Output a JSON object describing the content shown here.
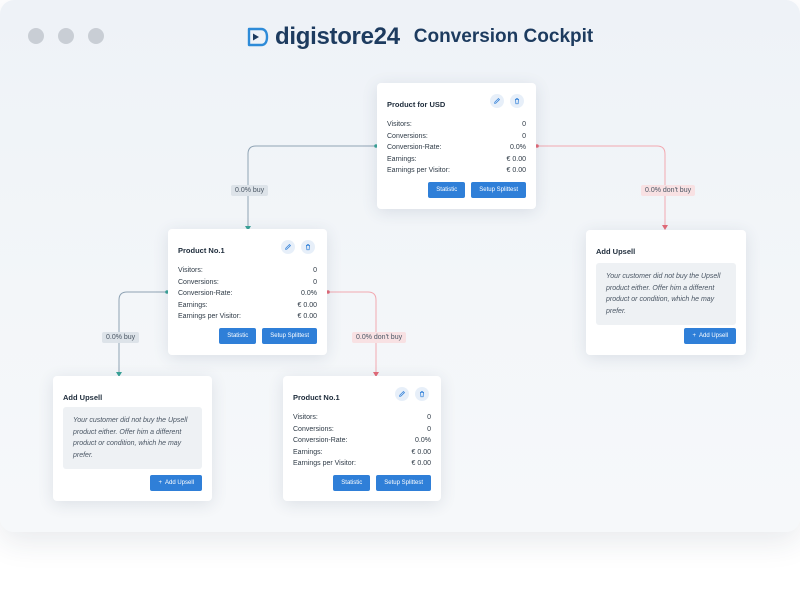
{
  "app": {
    "brand_name": "digistore24",
    "title": "Conversion Cockpit",
    "logo_icon": "digistore24-logo-icon"
  },
  "colors": {
    "brand": "#1d3b5f",
    "button": "#2f7fd8",
    "buy_line": "#8fa3b4",
    "buy_arrow": "#3aa398",
    "nobuy_line": "#f2a9b1",
    "nobuy_arrow": "#e36a78"
  },
  "stat_labels": {
    "visitors": "Visitors:",
    "conversions": "Conversions:",
    "rate": "Conversion-Rate:",
    "earnings": "Earnings:",
    "epv": "Earnings per Visitor:"
  },
  "buttons": {
    "statistic": "Statistic",
    "splittest": "Setup Splittest",
    "add_upsell": "Add Upsell"
  },
  "icons": {
    "edit": "pencil-icon",
    "delete": "trash-icon",
    "add": "plus-icon"
  },
  "root": {
    "title": "Product for USD",
    "visitors": "0",
    "conversions": "0",
    "rate": "0.0%",
    "earnings": "€  0.00",
    "epv": "€  0.00"
  },
  "left": {
    "title": "Product No.1",
    "visitors": "0",
    "conversions": "0",
    "rate": "0.0%",
    "earnings": "€  0.00",
    "epv": "€  0.00"
  },
  "bottom": {
    "title": "Product No.1",
    "visitors": "0",
    "conversions": "0",
    "rate": "0.0%",
    "earnings": "€  0.00",
    "epv": "€  0.00"
  },
  "upsell_right": {
    "title": "Add Upsell",
    "message": "Your customer did not buy the Upsell product either. Offer him a different product or condition, which he may prefer."
  },
  "upsell_left": {
    "title": "Add Upsell",
    "message": "Your customer did not buy the Upsell product either. Offer him a different product or condition, which he may prefer."
  },
  "connectors": {
    "root_buy": "0.0% buy",
    "root_nobuy": "0.0% don't buy",
    "left_buy": "0.0% buy",
    "left_nobuy": "0.0% don't buy"
  }
}
